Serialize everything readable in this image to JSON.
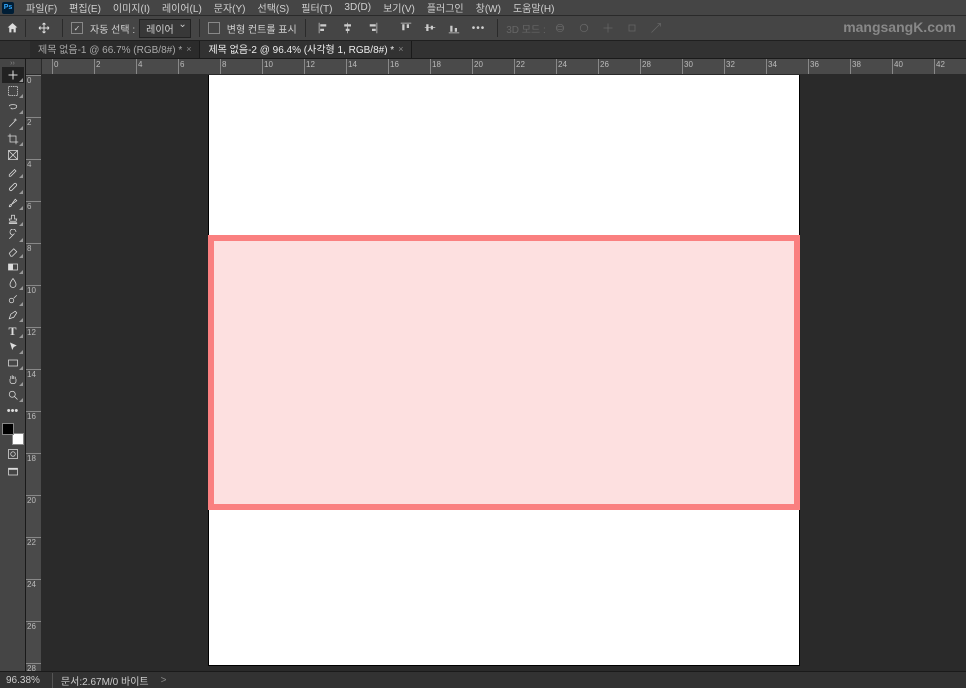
{
  "app": {
    "ps_label": "Ps"
  },
  "menubar": {
    "items": [
      {
        "label": "파일(F)"
      },
      {
        "label": "편집(E)"
      },
      {
        "label": "이미지(I)"
      },
      {
        "label": "레이어(L)"
      },
      {
        "label": "문자(Y)"
      },
      {
        "label": "선택(S)"
      },
      {
        "label": "필터(T)"
      },
      {
        "label": "3D(D)"
      },
      {
        "label": "보기(V)"
      },
      {
        "label": "플러그인"
      },
      {
        "label": "창(W)"
      },
      {
        "label": "도움말(H)"
      }
    ]
  },
  "options": {
    "auto_select_check": "✓",
    "auto_select_label": "자동 선택 :",
    "auto_select_value": "레이어",
    "show_transform_label": "변형 컨트롤 표시",
    "mode3d_label": "3D 모드 :"
  },
  "watermark": {
    "text": "mangsangK.com"
  },
  "tabs": [
    {
      "label": "제목 없음-1 @ 66.7% (RGB/8#) *",
      "active": false
    },
    {
      "label": "제목 없음-2 @ 96.4% (사각형 1, RGB/8#) *",
      "active": true
    }
  ],
  "ruler": {
    "h_numbers": [
      "0",
      "2",
      "4",
      "6",
      "8",
      "10",
      "12",
      "14",
      "16",
      "18",
      "20",
      "22",
      "24",
      "26",
      "28",
      "30",
      "32",
      "34",
      "36",
      "38",
      "40",
      "42"
    ],
    "v_numbers": [
      "0",
      "2",
      "4",
      "6",
      "8",
      "10",
      "12",
      "14",
      "16",
      "18",
      "20",
      "22",
      "24",
      "26",
      "28"
    ]
  },
  "toolbox": {
    "tools": [
      {
        "name": "move-tool",
        "active": true
      },
      {
        "name": "marquee-tool"
      },
      {
        "name": "lasso-tool"
      },
      {
        "name": "magic-wand-tool"
      },
      {
        "name": "crop-tool"
      },
      {
        "name": "frame-tool"
      },
      {
        "name": "eyedropper-tool"
      },
      {
        "name": "healing-brush-tool"
      },
      {
        "name": "brush-tool"
      },
      {
        "name": "clone-stamp-tool"
      },
      {
        "name": "history-brush-tool"
      },
      {
        "name": "eraser-tool"
      },
      {
        "name": "gradient-tool"
      },
      {
        "name": "blur-tool"
      },
      {
        "name": "dodge-tool"
      },
      {
        "name": "pen-tool"
      },
      {
        "name": "type-tool"
      },
      {
        "name": "path-selection-tool"
      },
      {
        "name": "rectangle-tool"
      },
      {
        "name": "hand-tool"
      },
      {
        "name": "zoom-tool"
      },
      {
        "name": "more-tools"
      }
    ]
  },
  "canvas": {
    "rect_fill": "#fde0e0",
    "rect_stroke": "#fa8080"
  },
  "status": {
    "zoom": "96.38%",
    "doc_info": "문서:2.67M/0 바이트",
    "caret": ">"
  }
}
